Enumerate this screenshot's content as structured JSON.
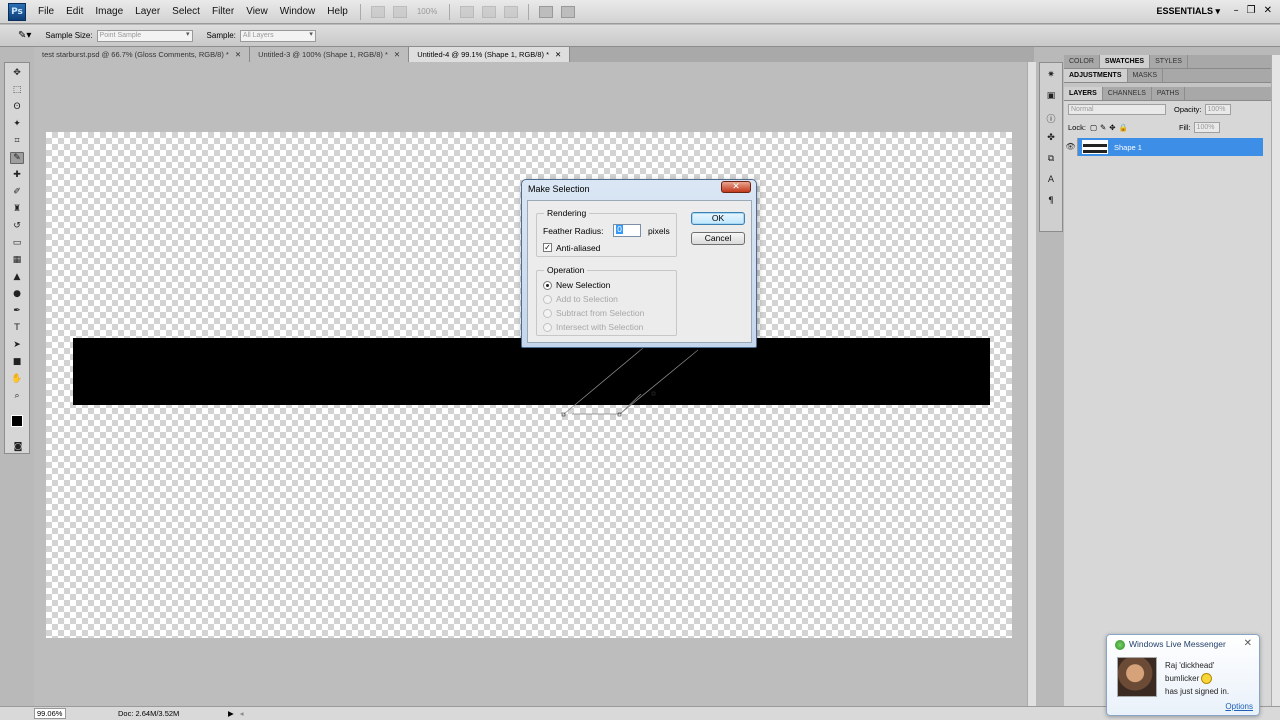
{
  "app": {
    "logo": "Ps",
    "workspace": "ESSENTIALS",
    "zoom_level": "100%"
  },
  "menu": [
    "File",
    "Edit",
    "Image",
    "Layer",
    "Select",
    "Filter",
    "View",
    "Window",
    "Help"
  ],
  "options_bar": {
    "sample_size_label": "Sample Size:",
    "sample_size_value": "Point Sample",
    "sample_label": "Sample:",
    "sample_value": "All Layers"
  },
  "doc_tabs": [
    {
      "label": "test starburst.psd @ 66.7% (Gloss Comments, RGB/8) *"
    },
    {
      "label": "Untitled-3 @ 100% (Shape 1, RGB/8) *"
    },
    {
      "label": "Untitled-4 @ 99.1% (Shape 1, RGB/8) *"
    }
  ],
  "status": {
    "zoom": "99.06%",
    "doc_info": "Doc: 2.64M/3.52M"
  },
  "dialog": {
    "title": "Make Selection",
    "rendering_title": "Rendering",
    "feather_label": "Feather Radius:",
    "feather_value": "0",
    "feather_unit": "pixels",
    "anti_aliased_label": "Anti-aliased",
    "anti_aliased_checked": true,
    "operation_title": "Operation",
    "operations": [
      {
        "label": "New Selection",
        "selected": true,
        "enabled": true
      },
      {
        "label": "Add to Selection",
        "selected": false,
        "enabled": false
      },
      {
        "label": "Subtract from Selection",
        "selected": false,
        "enabled": false
      },
      {
        "label": "Intersect with Selection",
        "selected": false,
        "enabled": false
      }
    ],
    "ok_label": "OK",
    "cancel_label": "Cancel"
  },
  "panels": {
    "top_tabs": [
      "COLOR",
      "SWATCHES",
      "STYLES"
    ],
    "mid_tabs": [
      "ADJUSTMENTS",
      "MASKS"
    ],
    "layer_tabs": [
      "LAYERS",
      "CHANNELS",
      "PATHS"
    ],
    "blend_mode": "Normal",
    "opacity_label": "Opacity:",
    "opacity_value": "100%",
    "lock_label": "Lock:",
    "fill_label": "Fill:",
    "fill_value": "100%",
    "layer_name": "Shape 1"
  },
  "messenger": {
    "title": "Windows Live Messenger",
    "line1": "Raj 'dickhead'",
    "line2": "bumlicker",
    "line3": "has just signed in.",
    "options": "Options"
  }
}
